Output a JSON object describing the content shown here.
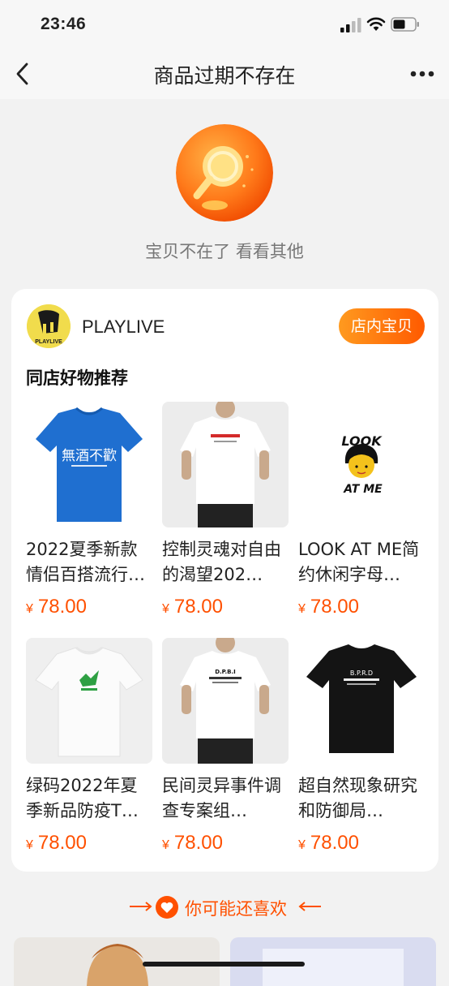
{
  "status": {
    "time": "23:46"
  },
  "nav": {
    "title": "商品过期不存在",
    "back_icon": "chevron-left-icon",
    "more_icon": "more-dots-icon"
  },
  "empty": {
    "message": "宝贝不在了 看看其他"
  },
  "shop": {
    "name": "PLAYLIVE",
    "button": "店内宝贝",
    "logo_text": "PLAYLIVE"
  },
  "section": {
    "title": "同店好物推荐"
  },
  "products": [
    {
      "name": "2022夏季新款情侣百搭流行…",
      "currency": "¥",
      "price": "78.00",
      "image": "blue-tshirt",
      "print": "無酒不歡"
    },
    {
      "name": "控制灵魂对自由的渴望202…",
      "currency": "¥",
      "price": "78.00",
      "image": "white-tshirt-model"
    },
    {
      "name": "LOOK AT ME简约休闲字母…",
      "currency": "¥",
      "price": "78.00",
      "image": "look-at-me-print",
      "print_top": "LOOK",
      "print_bottom": "AT ME"
    },
    {
      "name": "绿码2022年夏季新品防疫T…",
      "currency": "¥",
      "price": "78.00",
      "image": "white-tshirt-green-print"
    },
    {
      "name": "民间灵异事件调查专案组…",
      "currency": "¥",
      "price": "78.00",
      "image": "white-tshirt-model-2",
      "print": "D.P.B.I"
    },
    {
      "name": "超自然现象研究和防御局…",
      "currency": "¥",
      "price": "78.00",
      "image": "black-tshirt",
      "print": "B.P.R.D"
    }
  ],
  "recommend": {
    "label": "你可能还喜欢"
  },
  "colors": {
    "accent": "#ff5000",
    "button_start": "#ff9a1f",
    "button_end": "#ff5a00"
  }
}
